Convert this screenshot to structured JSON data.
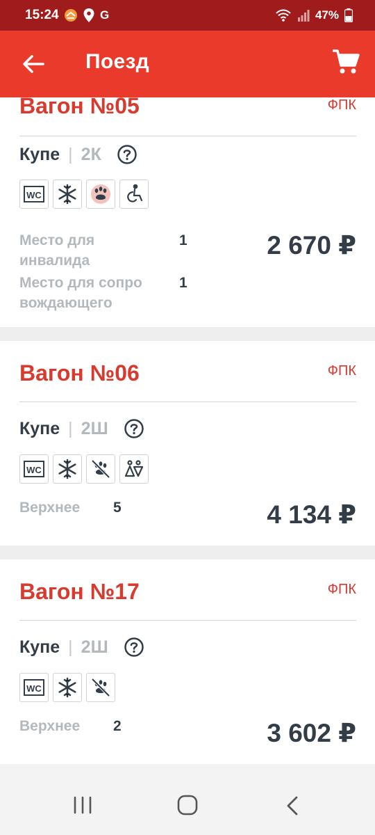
{
  "status_bar": {
    "time": "15:24",
    "battery": "47%",
    "carrier_letter": "G"
  },
  "app_bar": {
    "title": "Поезд"
  },
  "cars": [
    {
      "title": "Вагон №05",
      "carrier": "ФПК",
      "class_name": "Купе",
      "class_code": "2К",
      "amenities": [
        "wc-icon",
        "air-conditioning-icon",
        "pets-allowed-icon",
        "wheelchair-icon"
      ],
      "seats": [
        {
          "label": "Место для инвалида",
          "count": "1"
        },
        {
          "label": "Место для сопровождающего",
          "count": "1"
        }
      ],
      "price": "2 670 ₽"
    },
    {
      "title": "Вагон №06",
      "carrier": "ФПК",
      "class_name": "Купе",
      "class_code": "2Ш",
      "amenities": [
        "wc-icon",
        "air-conditioning-icon",
        "no-pets-icon",
        "mixed-gender-icon"
      ],
      "seats": [
        {
          "label": "Верхнее",
          "count": "5"
        }
      ],
      "price": "4 134 ₽"
    },
    {
      "title": "Вагон №17",
      "carrier": "ФПК",
      "class_name": "Купе",
      "class_code": "2Ш",
      "amenities": [
        "wc-icon",
        "air-conditioning-icon",
        "no-pets-icon"
      ],
      "seats": [
        {
          "label": "Верхнее",
          "count": "2"
        }
      ],
      "price": "3 602 ₽"
    }
  ],
  "colors": {
    "status_bar": "#a01b1b",
    "app_bar": "#ea3a2c",
    "accent_red": "#d83a2f",
    "text_dark": "#333d48",
    "text_muted": "#b3b8bd"
  }
}
